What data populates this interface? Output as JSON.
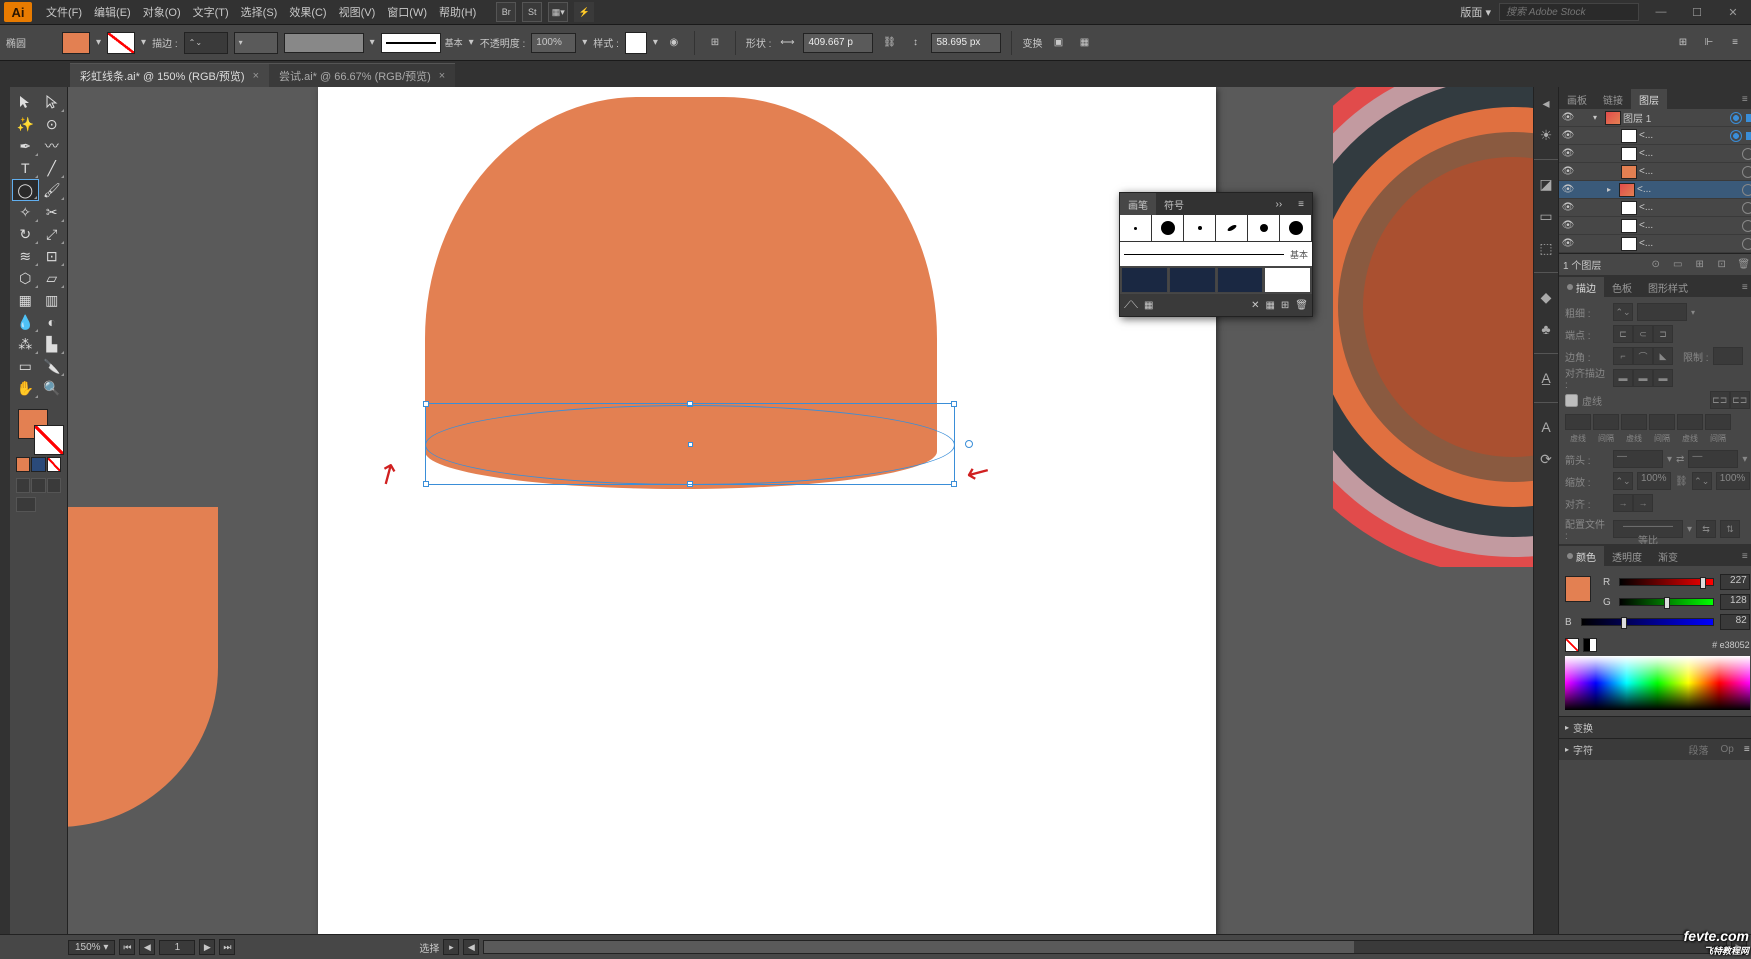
{
  "menubar": {
    "logo": "Ai",
    "items": [
      "文件(F)",
      "编辑(E)",
      "对象(O)",
      "文字(T)",
      "选择(S)",
      "效果(C)",
      "视图(V)",
      "窗口(W)",
      "帮助(H)"
    ],
    "right_icons": [
      "Br",
      "St"
    ],
    "layout_label": "版面",
    "search_placeholder": "搜索 Adobe Stock"
  },
  "controlbar": {
    "tool_label": "椭圆",
    "stroke_label": "描边 :",
    "brush_label": "基本",
    "opacity_label": "不透明度 :",
    "opacity_value": "100%",
    "style_label": "样式 :",
    "shape_label": "形状 :",
    "width_value": "409.667 p",
    "height_value": "58.695 px",
    "transform_label": "变换"
  },
  "tabs": [
    {
      "label": "彩虹线条.ai* @ 150% (RGB/预览)",
      "active": true
    },
    {
      "label": "尝试.ai* @ 66.67% (RGB/预览)",
      "active": false
    }
  ],
  "brush_panel": {
    "tabs": [
      "画笔",
      "符号"
    ],
    "basic_label": "基本",
    "bottom_icons": [
      "⟋",
      "✕",
      "▦",
      "⊞",
      "🗑"
    ]
  },
  "layers_panel": {
    "tabs": [
      "画板",
      "链接",
      "图层"
    ],
    "parent": "图层 1",
    "items": [
      "<...",
      "<...",
      "<...",
      "<...",
      "<...",
      "<...",
      "<..."
    ],
    "footer": "1 个图层"
  },
  "stroke_panel": {
    "tabs": [
      "描边",
      "色板",
      "图形样式"
    ],
    "weight_label": "粗细 :",
    "cap_label": "端点 :",
    "corner_label": "边角 :",
    "limit_label": "限制 :",
    "align_label": "对齐描边 :",
    "dash_check": "虚线",
    "dash_labels": [
      "虚线",
      "间隔",
      "虚线",
      "间隔",
      "虚线",
      "间隔"
    ],
    "arrow_label": "箭头 :",
    "scale_label": "缩放 :",
    "scale_values": [
      "100%",
      "100%"
    ],
    "alignarrow_label": "对齐 :",
    "profile_label": "配置文件 :",
    "profile_value": "等比"
  },
  "color_panel": {
    "tabs": [
      "颜色",
      "透明度",
      "渐变"
    ],
    "r": 227,
    "g": 128,
    "b": 82,
    "hex": "e38052"
  },
  "collapsed_panels": {
    "transform": "变换",
    "char": "字符",
    "para": "段落",
    "ot": "Op"
  },
  "statusbar": {
    "zoom": "150%",
    "artboard_num": "1",
    "selection": "选择"
  },
  "watermark": {
    "main": "fevte.com",
    "sub": "飞特教程网"
  },
  "right_iconstrip": {
    "icons": [
      "≡",
      "◪",
      "▭",
      "⬚",
      "◆",
      "♣",
      "A",
      "␣",
      "A",
      "⟳",
      "⊞"
    ]
  }
}
